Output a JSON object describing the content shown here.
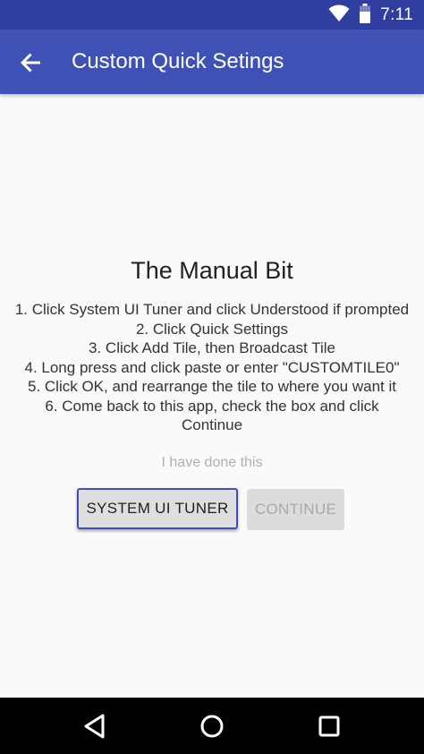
{
  "status_bar": {
    "time": "7:11",
    "icons": [
      "wifi-icon",
      "battery-icon"
    ],
    "color": "#303f9f"
  },
  "app_bar": {
    "title": "Custom Quick Setings",
    "back_icon": "arrow-back-icon",
    "color": "#3f51b5"
  },
  "main": {
    "heading": "The Manual Bit",
    "steps": [
      "1. Click System UI Tuner and click Understood if prompted",
      "2. Click Quick Settings",
      "3. Click Add Tile, then Broadcast Tile",
      "4. Long press and click paste or enter \"CUSTOMTILE0\"",
      "5. Click OK, and rearrange the tile to where you want it",
      "6. Come back to this app, check the box and click Continue"
    ],
    "done_checkbox_label": "I have done this",
    "system_ui_tuner_button": "SYSTEM UI TUNER",
    "continue_button": "CONTINUE"
  },
  "nav_bar": {
    "icons": [
      "back-triangle-icon",
      "home-circle-icon",
      "recents-square-icon"
    ]
  }
}
